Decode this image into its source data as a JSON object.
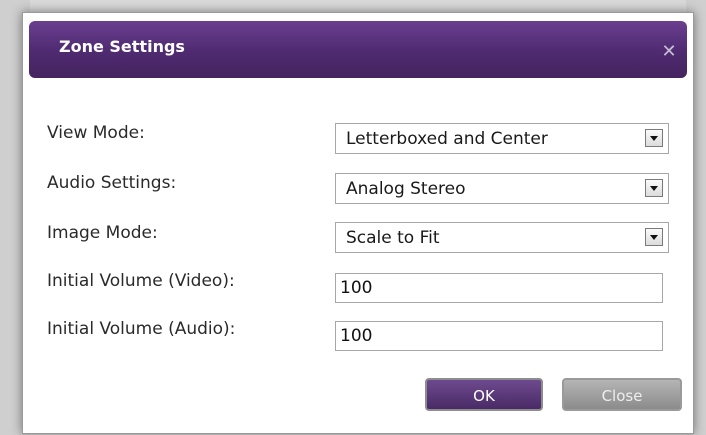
{
  "dialog": {
    "title": "Zone Settings",
    "close_icon": "close-icon"
  },
  "fields": {
    "view_mode": {
      "label": "View Mode:",
      "value": "Letterboxed and Center"
    },
    "audio_settings": {
      "label": "Audio Settings:",
      "value": "Analog Stereo"
    },
    "image_mode": {
      "label": "Image Mode:",
      "value": "Scale to Fit"
    },
    "initial_volume_video": {
      "label": "Initial Volume (Video):",
      "value": "100"
    },
    "initial_volume_audio": {
      "label": "Initial Volume (Audio):",
      "value": "100"
    }
  },
  "buttons": {
    "ok": "OK",
    "close": "Close"
  },
  "colors": {
    "titlebar": "#4e2a70",
    "ok_button": "#5a3a7a",
    "close_button": "#9e9e9e"
  }
}
